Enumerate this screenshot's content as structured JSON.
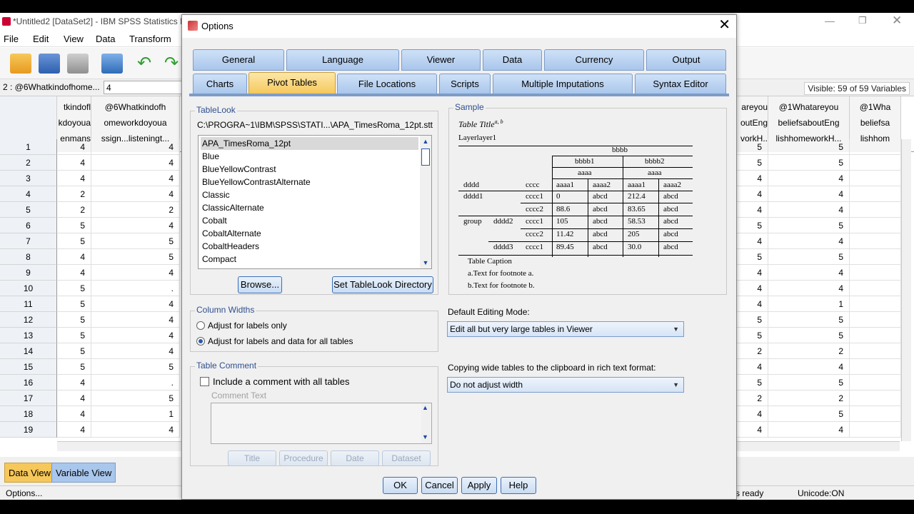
{
  "app": {
    "title": "*Untitled2 [DataSet2] - IBM SPSS Statistics D",
    "menu": [
      "File",
      "Edit",
      "View",
      "Data",
      "Transform"
    ],
    "cell_ref": "2 : @6Whatkindofhome...",
    "cell_value": "4",
    "visible": "Visible: 59 of 59 Variables",
    "col_headers_left": [
      [
        "tkindofl",
        "kdoyoua",
        "enmans"
      ],
      [
        "@6Whatkindofh",
        "omeworkdoyoua",
        "ssign...listeningt..."
      ]
    ],
    "col_headers_right": [
      [
        "areyou",
        "outEng",
        "vorkH.."
      ],
      [
        "@1Whatareyou",
        "beliefsaboutEng",
        "lishhomeworkH..."
      ],
      [
        "@1Wha",
        "beliefsa",
        "lishhom"
      ]
    ],
    "rows": [
      {
        "n": "1",
        "a": "4",
        "b": "4",
        "c": "5",
        "d": "5"
      },
      {
        "n": "2",
        "a": "4",
        "b": "4",
        "c": "5",
        "d": "5"
      },
      {
        "n": "3",
        "a": "4",
        "b": "4",
        "c": "4",
        "d": "4"
      },
      {
        "n": "4",
        "a": "2",
        "b": "4",
        "c": "4",
        "d": "4"
      },
      {
        "n": "5",
        "a": "2",
        "b": "2",
        "c": "4",
        "d": "4"
      },
      {
        "n": "6",
        "a": "5",
        "b": "4",
        "c": "5",
        "d": "5"
      },
      {
        "n": "7",
        "a": "5",
        "b": "5",
        "c": "4",
        "d": "4"
      },
      {
        "n": "8",
        "a": "4",
        "b": "5",
        "c": "5",
        "d": "5"
      },
      {
        "n": "9",
        "a": "4",
        "b": "4",
        "c": "4",
        "d": "4"
      },
      {
        "n": "10",
        "a": "5",
        "b": ".",
        "c": "4",
        "d": "4"
      },
      {
        "n": "11",
        "a": "5",
        "b": "4",
        "c": "4",
        "d": "1"
      },
      {
        "n": "12",
        "a": "5",
        "b": "4",
        "c": "5",
        "d": "5"
      },
      {
        "n": "13",
        "a": "5",
        "b": "4",
        "c": "5",
        "d": "5"
      },
      {
        "n": "14",
        "a": "5",
        "b": "4",
        "c": "2",
        "d": "2"
      },
      {
        "n": "15",
        "a": "5",
        "b": "5",
        "c": "4",
        "d": "4"
      },
      {
        "n": "16",
        "a": "4",
        "b": ".",
        "c": "5",
        "d": "5"
      },
      {
        "n": "17",
        "a": "4",
        "b": "5",
        "c": "2",
        "d": "2"
      },
      {
        "n": "18",
        "a": "4",
        "b": "1",
        "c": "4",
        "d": "5"
      },
      {
        "n": "19",
        "a": "4",
        "b": "4",
        "c": "4",
        "d": "4"
      }
    ],
    "view_tabs": [
      "Data View",
      "Variable View"
    ],
    "status_left": "Options...",
    "status_ready": "s ready",
    "status_unicode": "Unicode:ON"
  },
  "dialog": {
    "title": "Options",
    "tabs_row1": [
      "General",
      "Language",
      "Viewer",
      "Data",
      "Currency",
      "Output"
    ],
    "tabs_row2": [
      "Charts",
      "Pivot Tables",
      "File Locations",
      "Scripts",
      "Multiple Imputations",
      "Syntax Editor"
    ],
    "active_tab": "Pivot Tables",
    "tablelook": {
      "label": "TableLook",
      "path": "C:\\PROGRA~1\\IBM\\SPSS\\STATI...\\APA_TimesRoma_12pt.stt",
      "items": [
        "APA_TimesRoma_12pt",
        "Blue",
        "BlueYellowContrast",
        "BlueYellowContrastAlternate",
        "Classic",
        "ClassicAlternate",
        "Cobalt",
        "CobaltAlternate",
        "CobaltHeaders",
        "Compact"
      ],
      "selected": "APA_TimesRoma_12pt",
      "browse": "Browse...",
      "set_dir": "Set TableLook Directory"
    },
    "sample": {
      "label": "Sample",
      "title": "Table Title",
      "title_sup": "a, b",
      "layer": "Layerlayer1",
      "bbbb": "bbbb",
      "bbbb1": "bbbb1",
      "bbbb2": "bbbb2",
      "aaaa": "aaaa",
      "aaaa1": "aaaa1",
      "aaaa2": "aaaa2",
      "dddd": "dddd",
      "cccc": "cccc",
      "group": "group",
      "dddd1": "dddd1",
      "dddd2": "dddd2",
      "dddd3": "dddd3",
      "cccc1": "cccc1",
      "cccc2": "cccc2",
      "abcd": "abcd",
      "v": [
        "0",
        "212.4",
        "88.6",
        "83.65",
        "105",
        "58.53",
        "11.42",
        "205",
        "89.45",
        "30.0"
      ],
      "caption": "Table Caption",
      "fn_a": "a.Text for footnote a.",
      "fn_b": "b.Text for footnote b."
    },
    "column_widths": {
      "label": "Column Widths",
      "opt1": "Adjust for labels only",
      "opt2": "Adjust for labels and data for all tables",
      "selected": 2
    },
    "table_comment": {
      "label": "Table Comment",
      "include": "Include a comment with all tables",
      "comment_text": "Comment Text",
      "buttons": [
        "Title",
        "Procedure",
        "Date",
        "Dataset"
      ]
    },
    "editing_mode": {
      "label": "Default Editing Mode:",
      "value": "Edit all but very large tables in Viewer"
    },
    "copying": {
      "label": "Copying wide tables to the clipboard in rich text format:",
      "value": "Do not adjust width"
    },
    "footer": [
      "OK",
      "Cancel",
      "Apply",
      "Help"
    ]
  }
}
